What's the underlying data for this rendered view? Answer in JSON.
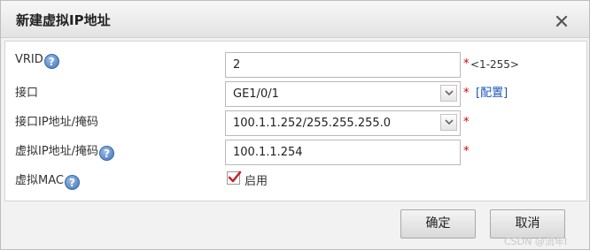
{
  "dialog": {
    "title": "新建虚拟IP地址",
    "close_icon": "close-icon"
  },
  "form": {
    "vrid": {
      "label": "VRID",
      "value": "2",
      "required_mark": "*",
      "hint": "<1-255>",
      "help_icon": "help-icon"
    },
    "interface": {
      "label": "接口",
      "selected": "GE1/0/1",
      "required_mark": "*",
      "config_link": "[配置]",
      "dropdown_icon": "chevron-down-icon"
    },
    "interface_ip_mask": {
      "label": "接口IP地址/掩码",
      "selected": "100.1.1.252/255.255.255.0",
      "required_mark": "*",
      "dropdown_icon": "chevron-down-icon"
    },
    "virtual_ip_mask": {
      "label": "虚拟IP地址/掩码",
      "value": "100.1.1.254",
      "required_mark": "*",
      "help_icon": "help-icon"
    },
    "virtual_mac": {
      "label": "虚拟MAC",
      "checkbox_label": "启用",
      "checked": true,
      "help_icon": "help-icon"
    }
  },
  "footer": {
    "ok_label": "确定",
    "cancel_label": "取消",
    "watermark": "CSDN @流年I"
  },
  "colors": {
    "required": "#d00000",
    "link": "#1a56b8",
    "help_icon": "#3f73b8",
    "checkmark": "#c0282d"
  }
}
